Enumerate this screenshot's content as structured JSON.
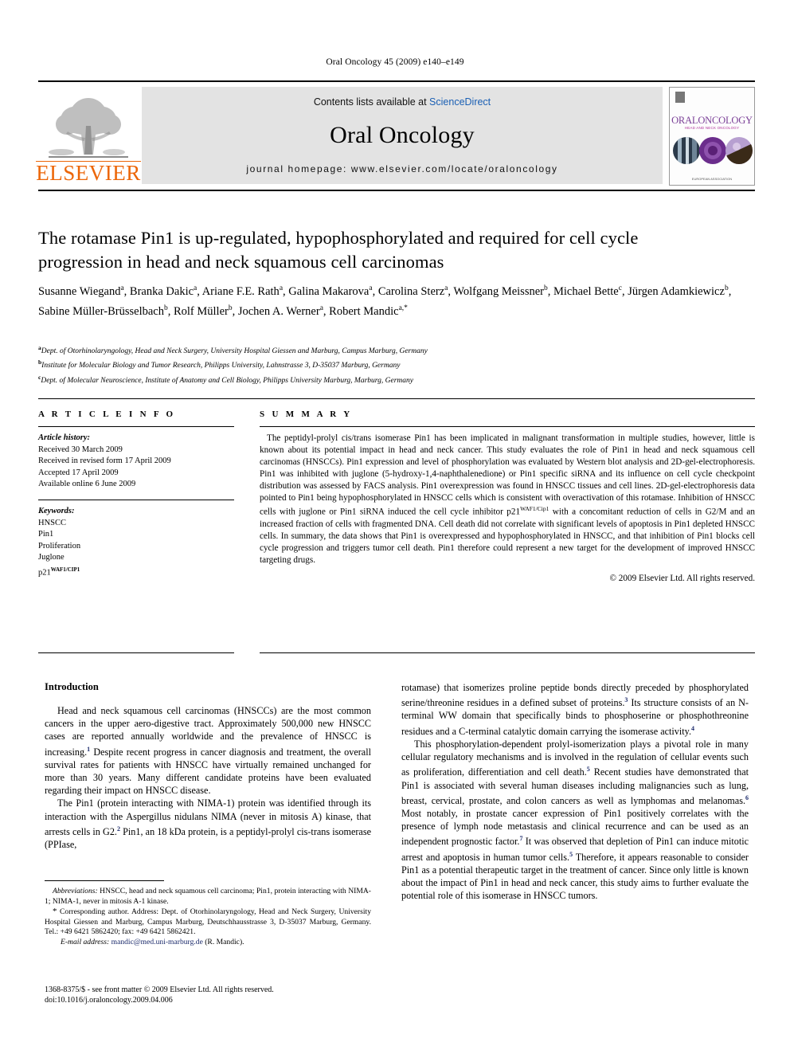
{
  "running_head": "Oral Oncology 45 (2009) e140–e149",
  "masthead": {
    "contents_prefix": "Contents lists available at ",
    "sciencedirect": "ScienceDirect",
    "journal_name": "Oral Oncology",
    "homepage": "journal homepage: www.elsevier.com/locate/oraloncology",
    "publisher_wordmark": "ELSEVIER",
    "cover": {
      "title": "ORALONCOLOGY",
      "subtitle": "HEAD AND NECK ONCOLOGY",
      "footer": "EUROPEAN ASSOCIATION"
    },
    "accent_color": "#1a5fb4",
    "elsevier_orange": "#EC6608",
    "cover_purple": "#7a3f97"
  },
  "article": {
    "title": "The rotamase Pin1 is up-regulated, hypophosphorylated and required for cell cycle progression in head and neck squamous cell carcinomas",
    "authors": "Susanne Wiegand a, Branka Dakic a, Ariane F.E. Rath a, Galina Makarova a, Carolina Sterz a, Wolfgang Meissner b, Michael Bette c, Jürgen Adamkiewicz b, Sabine Müller-Brüsselbach b, Rolf Müller b, Jochen A. Werner a, Robert Mandic a,*",
    "affiliations": [
      {
        "mark": "a",
        "text": "Dept. of Otorhinolaryngology, Head and Neck Surgery, University Hospital Giessen and Marburg, Campus Marburg, Germany"
      },
      {
        "mark": "b",
        "text": "Institute for Molecular Biology and Tumor Research, Philipps University, Lahnstrasse 3, D-35037 Marburg, Germany"
      },
      {
        "mark": "c",
        "text": "Dept. of Molecular Neuroscience, Institute of Anatomy and Cell Biology, Philipps University Marburg, Marburg, Germany"
      }
    ]
  },
  "article_info": {
    "heading": "A R T I C L E   I N F O",
    "history_label": "Article history:",
    "history": [
      "Received 30 March 2009",
      "Received in revised form 17 April 2009",
      "Accepted 17 April 2009",
      "Available online 6 June 2009"
    ],
    "keywords_label": "Keywords:",
    "keywords": [
      "HNSCC",
      "Pin1",
      "Proliferation",
      "Juglone"
    ],
    "keyword_last_base": "p21",
    "keyword_last_sup": "WAF1/CIP1"
  },
  "summary": {
    "heading": "S U M M A R Y",
    "paragraph_1": "The peptidyl-prolyl cis/trans isomerase Pin1 has been implicated in malignant transformation in multiple studies, however, little is known about its potential impact in head and neck cancer. This study evaluates the role of Pin1 in head and neck squamous cell carcinomas (HNSCCs). Pin1 expression and level of phosphorylation was evaluated by Western blot analysis and 2D-gel-electrophoresis. Pin1 was inhibited with juglone (5-hydroxy-1,4-naphthalenedione) or Pin1 specific siRNA and its influence on cell cycle checkpoint distribution was assessed by FACS analysis. Pin1 overexpression was found in HNSCC tissues and cell lines. 2D-gel-electrophoresis data pointed to Pin1 being hypophosphorylated in HNSCC cells which is consistent with overactivation of this rotamase. Inhibition of HNSCC cells with juglone or Pin1 siRNA induced the cell cycle inhibitor p21",
    "sup_1": "WAF1/Cip1",
    "paragraph_1_cont": " with a concomitant reduction of cells in G2/M and an increased fraction of cells with fragmented DNA. Cell death did not correlate with significant levels of apoptosis in Pin1 depleted HNSCC cells. In summary, the data shows that Pin1 is overexpressed and hypophosphorylated in HNSCC, and that inhibition of Pin1 blocks cell cycle progression and triggers tumor cell death. Pin1 therefore could represent a new target for the development of improved HNSCC targeting drugs.",
    "copyright": "© 2009 Elsevier Ltd. All rights reserved."
  },
  "introduction": {
    "heading": "Introduction",
    "left_paragraphs": [
      {
        "before": "Head and neck squamous cell carcinomas (HNSCCs) are the most common cancers in the upper aero-digestive tract. Approximately 500,000 new HNSCC cases are reported annually worldwide and the prevalence of HNSCC is increasing.",
        "sup": "1",
        "after": " Despite recent progress in cancer diagnosis and treatment, the overall survival rates for patients with HNSCC have virtually remained unchanged for more than 30 years. Many different candidate proteins have been evaluated regarding their impact on HNSCC disease."
      },
      {
        "before": "The Pin1 (protein interacting with NIMA-1) protein was identified through its interaction with the Aspergillus nidulans NIMA (never in mitosis A) kinase, that arrests cells in G2.",
        "sup": "2",
        "after": " Pin1, an 18 kDa protein, is a peptidyl-prolyl cis-trans isomerase (PPIase,"
      }
    ],
    "right_paragraphs": [
      {
        "before": "rotamase) that isomerizes proline peptide bonds directly preceded by phosphorylated serine/threonine residues in a defined subset of proteins.",
        "sup": "3",
        "mid": " Its structure consists of an N-terminal WW domain that specifically binds to phosphoserine or phosphothreonine residues and a C-terminal catalytic domain carrying the isomerase activity.",
        "sup2": "4",
        "after": ""
      },
      {
        "before": "This phosphorylation-dependent prolyl-isomerization plays a pivotal role in many cellular regulatory mechanisms and is involved in the regulation of cellular events such as proliferation, differentiation and cell death.",
        "sup": "5",
        "mid": " Recent studies have demonstrated that Pin1 is associated with several human diseases including malignancies such as lung, breast, cervical, prostate, and colon cancers as well as lymphomas and melanomas.",
        "sup2": "6",
        "mid2": " Most notably, in prostate cancer expression of Pin1 positively correlates with the presence of lymph node metastasis and clinical recurrence and can be used as an independent prognostic factor.",
        "sup3": "7",
        "mid3": " It was observed that depletion of Pin1 can induce mitotic arrest and apoptosis in human tumor cells.",
        "sup4": "5",
        "after": " Therefore, it appears reasonable to consider Pin1 as a potential therapeutic target in the treatment of cancer. Since only little is known about the impact of Pin1 in head and neck cancer, this study aims to further evaluate the potential role of this isomerase in HNSCC tumors."
      }
    ]
  },
  "footnotes": {
    "abbreviations_label": "Abbreviations:",
    "abbreviations_text": " HNSCC, head and neck squamous cell carcinoma; Pin1, protein interacting with NIMA-1; NIMA-1, never in mitosis A-1 kinase.",
    "corresponding_marker": "*",
    "corresponding_text": " Corresponding author. Address: Dept. of Otorhinolaryngology, Head and Neck Surgery, University Hospital Giessen and Marburg, Campus Marburg, Deutschhausstrasse 3, D-35037 Marburg, Germany. Tel.: +49 6421 5862420; fax: +49 6421 5862421.",
    "email_label": "E-mail address:",
    "email": "mandic@med.uni-marburg.de",
    "email_suffix": " (R. Mandic).",
    "email_color": "#1b2a6b"
  },
  "imprint": {
    "line1": "1368-8375/$ - see front matter © 2009 Elsevier Ltd. All rights reserved.",
    "line2": "doi:10.1016/j.oraloncology.2009.04.006"
  }
}
